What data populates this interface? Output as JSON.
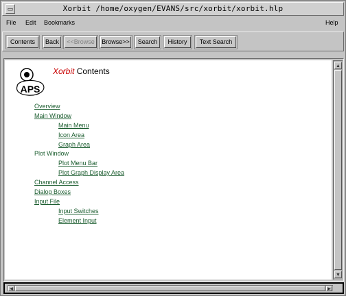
{
  "window": {
    "title": "Xorbit   /home/oxygen/EVANS/src/xorbit/xorbit.hlp",
    "menu_button_icon": "window-menu-icon"
  },
  "menubar": {
    "file": "File",
    "edit": "Edit",
    "bookmarks": "Bookmarks",
    "help": "Help"
  },
  "toolbar": {
    "contents": "Contents",
    "back": "Back",
    "browse_back": "<<Browse",
    "browse_fwd": "Browse>>",
    "search": "Search",
    "history": "History",
    "text_search": "Text Search"
  },
  "document": {
    "brand": "Xorbit",
    "heading": "Contents",
    "logo_text": "APS",
    "logo_icon": "aps-logo-icon",
    "toc": [
      {
        "label": "Overview",
        "level": 1
      },
      {
        "label": "Main Window",
        "level": 1
      },
      {
        "label": "Main Menu",
        "level": 2
      },
      {
        "label": "Icon Area",
        "level": 2
      },
      {
        "label": "Graph Area",
        "level": 2
      },
      {
        "label": "Plot Window",
        "level": 1
      },
      {
        "label": "Plot Menu Bar",
        "level": 2
      },
      {
        "label": "Plot Graph Display Area",
        "level": 2
      },
      {
        "label": "Channel Access",
        "level": 1
      },
      {
        "label": "Dialog Boxes",
        "level": 1
      },
      {
        "label": "Input File",
        "level": 1
      },
      {
        "label": "Input Switches",
        "level": 2
      },
      {
        "label": "Element Input",
        "level": 2
      }
    ]
  },
  "colors": {
    "link": "#1a5c2e",
    "brand": "#c80000",
    "chrome": "#c4c4c4"
  }
}
